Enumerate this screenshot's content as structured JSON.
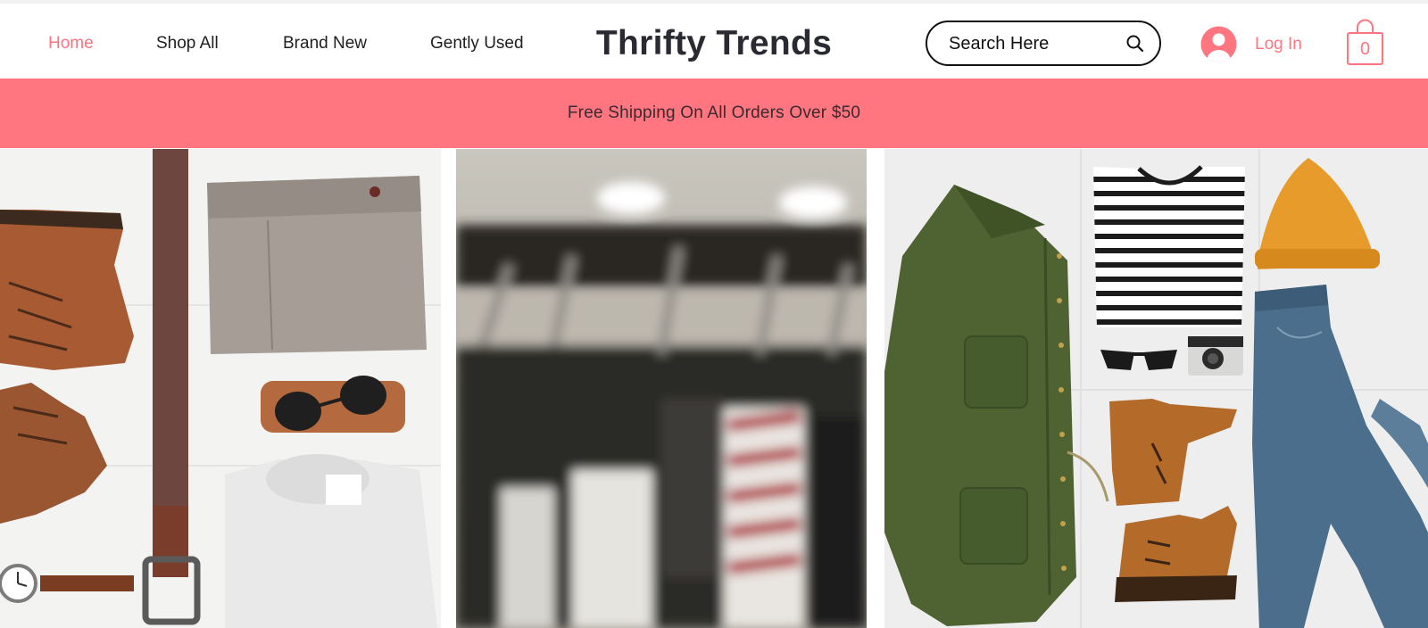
{
  "nav": {
    "items": [
      {
        "label": "Home",
        "active": true
      },
      {
        "label": "Shop All",
        "active": false
      },
      {
        "label": "Brand New",
        "active": false
      },
      {
        "label": "Gently Used",
        "active": false
      }
    ]
  },
  "brand": {
    "name": "Thrifty Trends"
  },
  "search": {
    "placeholder": "Search Here",
    "icon": "search-icon"
  },
  "account": {
    "login_label": "Log In",
    "icon": "user-avatar-icon"
  },
  "cart": {
    "count": "0",
    "icon": "shopping-bag-icon"
  },
  "banner": {
    "text": "Free Shipping On All Orders Over $50"
  },
  "colors": {
    "accent": "#ff7580",
    "text_dark": "#2a2a33",
    "banner_text": "#3b2a2e",
    "white": "#ffffff"
  },
  "gallery": {
    "tiles": [
      {
        "name": "flat-lay-menswear-photo"
      },
      {
        "name": "clothing-rack-hangers-photo"
      },
      {
        "name": "flat-lay-casual-outfit-photo"
      }
    ]
  }
}
